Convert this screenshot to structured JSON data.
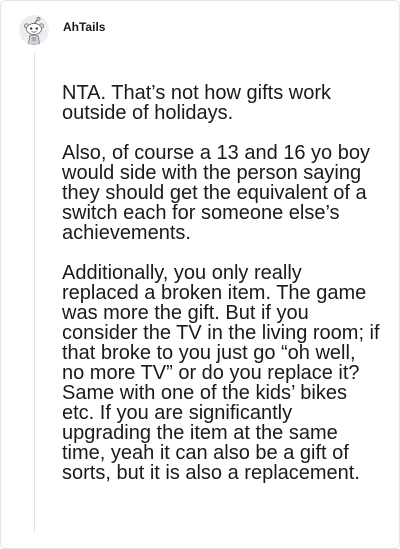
{
  "comment": {
    "author": "AhTails",
    "avatar_icon": "snoo-avatar-icon",
    "paragraphs": [
      "NTA. That’s not how gifts work outside of holidays.",
      "Also, of course a 13 and 16 yo boy would side with the person saying they should get the equivalent of a switch each for someone else’s achievements.",
      "Additionally, you only really replaced a broken item. The game was more the gift. But if you consider the TV in the living room; if that broke to you just go “oh well, no more TV” or do you replace it? Same with one of the kids’ bikes etc. If you are significantly upgrading the item at the same time, yeah it can also be a gift of sorts, but it is also a replacement."
    ]
  },
  "colors": {
    "text": "#1a1a1b",
    "thread_line": "#e3e3e3",
    "avatar_bg": "#f0f1f3"
  }
}
